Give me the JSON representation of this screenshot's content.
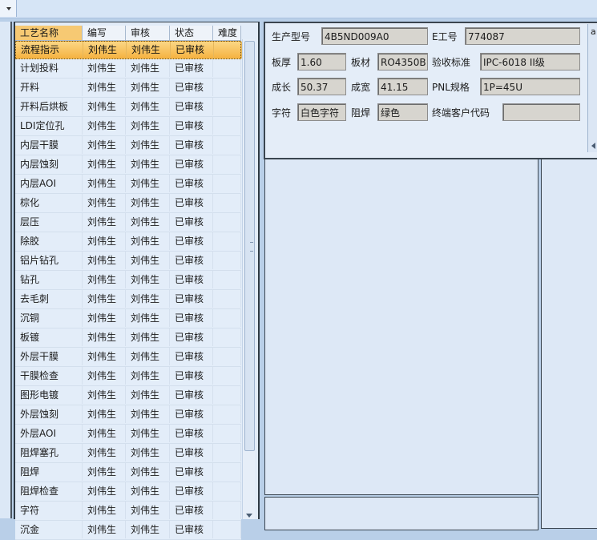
{
  "table": {
    "columns": [
      "工艺名称",
      "编写",
      "审核",
      "状态",
      "难度"
    ],
    "rows": [
      {
        "name": "流程指示",
        "writer": "刘伟生",
        "reviewer": "刘伟生",
        "status": "已审核",
        "difficulty": ""
      },
      {
        "name": "计划投料",
        "writer": "刘伟生",
        "reviewer": "刘伟生",
        "status": "已审核",
        "difficulty": ""
      },
      {
        "name": "开料",
        "writer": "刘伟生",
        "reviewer": "刘伟生",
        "status": "已审核",
        "difficulty": ""
      },
      {
        "name": "开料后烘板",
        "writer": "刘伟生",
        "reviewer": "刘伟生",
        "status": "已审核",
        "difficulty": ""
      },
      {
        "name": "LDI定位孔",
        "writer": "刘伟生",
        "reviewer": "刘伟生",
        "status": "已审核",
        "difficulty": ""
      },
      {
        "name": "内层干膜",
        "writer": "刘伟生",
        "reviewer": "刘伟生",
        "status": "已审核",
        "difficulty": ""
      },
      {
        "name": "内层蚀刻",
        "writer": "刘伟生",
        "reviewer": "刘伟生",
        "status": "已审核",
        "difficulty": ""
      },
      {
        "name": "内层AOI",
        "writer": "刘伟生",
        "reviewer": "刘伟生",
        "status": "已审核",
        "difficulty": ""
      },
      {
        "name": "棕化",
        "writer": "刘伟生",
        "reviewer": "刘伟生",
        "status": "已审核",
        "difficulty": ""
      },
      {
        "name": "层压",
        "writer": "刘伟生",
        "reviewer": "刘伟生",
        "status": "已审核",
        "difficulty": ""
      },
      {
        "name": "除胶",
        "writer": "刘伟生",
        "reviewer": "刘伟生",
        "status": "已审核",
        "difficulty": ""
      },
      {
        "name": "铝片钻孔",
        "writer": "刘伟生",
        "reviewer": "刘伟生",
        "status": "已审核",
        "difficulty": ""
      },
      {
        "name": "钻孔",
        "writer": "刘伟生",
        "reviewer": "刘伟生",
        "status": "已审核",
        "difficulty": ""
      },
      {
        "name": "去毛刺",
        "writer": "刘伟生",
        "reviewer": "刘伟生",
        "status": "已审核",
        "difficulty": ""
      },
      {
        "name": "沉铜",
        "writer": "刘伟生",
        "reviewer": "刘伟生",
        "status": "已审核",
        "difficulty": ""
      },
      {
        "name": "板镀",
        "writer": "刘伟生",
        "reviewer": "刘伟生",
        "status": "已审核",
        "difficulty": ""
      },
      {
        "name": "外层干膜",
        "writer": "刘伟生",
        "reviewer": "刘伟生",
        "status": "已审核",
        "difficulty": ""
      },
      {
        "name": "干膜检查",
        "writer": "刘伟生",
        "reviewer": "刘伟生",
        "status": "已审核",
        "difficulty": ""
      },
      {
        "name": "图形电镀",
        "writer": "刘伟生",
        "reviewer": "刘伟生",
        "status": "已审核",
        "difficulty": ""
      },
      {
        "name": "外层蚀刻",
        "writer": "刘伟生",
        "reviewer": "刘伟生",
        "status": "已审核",
        "difficulty": ""
      },
      {
        "name": "外层AOI",
        "writer": "刘伟生",
        "reviewer": "刘伟生",
        "status": "已审核",
        "difficulty": ""
      },
      {
        "name": "阻焊塞孔",
        "writer": "刘伟生",
        "reviewer": "刘伟生",
        "status": "已审核",
        "difficulty": ""
      },
      {
        "name": "阻焊",
        "writer": "刘伟生",
        "reviewer": "刘伟生",
        "status": "已审核",
        "difficulty": ""
      },
      {
        "name": "阻焊检查",
        "writer": "刘伟生",
        "reviewer": "刘伟生",
        "status": "已审核",
        "difficulty": ""
      },
      {
        "name": "字符",
        "writer": "刘伟生",
        "reviewer": "刘伟生",
        "status": "已审核",
        "difficulty": ""
      },
      {
        "name": "沉金",
        "writer": "刘伟生",
        "reviewer": "刘伟生",
        "status": "已审核",
        "difficulty": ""
      }
    ],
    "selected_index": 0
  },
  "info": {
    "production_model_label": "生产型号",
    "production_model": "4B5ND009A0",
    "e_number_label": "E工号",
    "e_number": "774087",
    "thickness_label": "板厚",
    "thickness": "1.60",
    "material_label": "板材",
    "material": "RO4350B",
    "acceptance_label": "验收标准",
    "acceptance": "IPC-6018 II级",
    "length_label": "成长",
    "length": "50.37",
    "width_label": "成宽",
    "width": "41.15",
    "pnl_label": "PNL规格",
    "pnl": "1P=45U",
    "char_label": "字符",
    "char": "白色字符",
    "solder_label": "阻焊",
    "solder": "绿色",
    "customer_code_label": "终端客户代码",
    "customer_code": ""
  },
  "side_tab_label": "a"
}
